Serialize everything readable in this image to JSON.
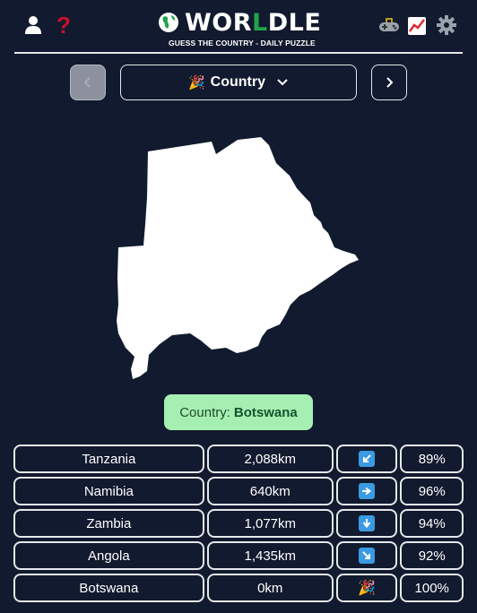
{
  "app": {
    "title": "WORLDLE",
    "title_pre": "WOR",
    "title_accent": "L",
    "title_post": "DLE",
    "subtitle": "GUESS THE COUNTRY - DAILY PUZZLE"
  },
  "header": {
    "left_icons": [
      "user-icon",
      "help-icon"
    ],
    "help_glyph": "?",
    "right_icons": [
      "games-icon",
      "stats-icon",
      "settings-icon"
    ]
  },
  "nav": {
    "prev_icon": "chevron-left-icon",
    "next_icon": "chevron-right-icon",
    "selected_mode": "Country",
    "mode_emoji": "🎉"
  },
  "answer": {
    "prefix": "Country:",
    "name": "Botswana"
  },
  "guesses": [
    {
      "country": "Tanzania",
      "distance": "2,088km",
      "direction": "south-west",
      "direction_glyph": "↙",
      "percent": "89%"
    },
    {
      "country": "Namibia",
      "distance": "640km",
      "direction": "east",
      "direction_glyph": "➡",
      "percent": "96%"
    },
    {
      "country": "Zambia",
      "distance": "1,077km",
      "direction": "south",
      "direction_glyph": "⬇",
      "percent": "94%"
    },
    {
      "country": "Angola",
      "distance": "1,435km",
      "direction": "south-east",
      "direction_glyph": "↘",
      "percent": "92%"
    },
    {
      "country": "Botswana",
      "distance": "0km",
      "direction": "correct",
      "direction_glyph": "🎉",
      "percent": "100%"
    }
  ],
  "colors": {
    "background": "#111a2e",
    "accent_green": "#22a34a",
    "answer_bg": "#a6efb2",
    "help_red": "#c8102e",
    "arrow_blue": "#3b9ae1"
  }
}
